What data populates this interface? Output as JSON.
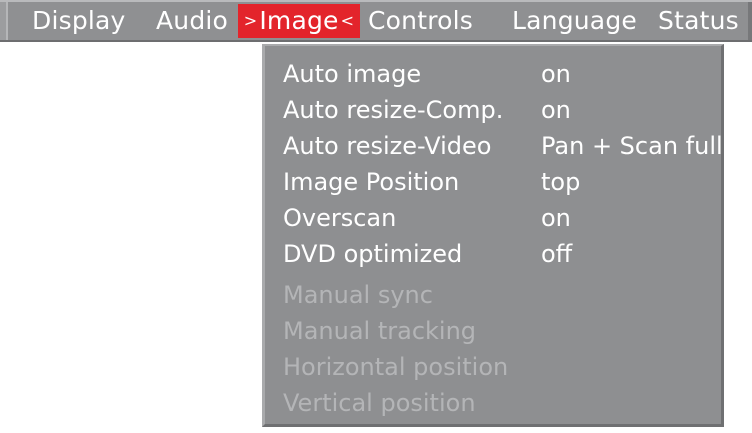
{
  "menubar": {
    "tabs": [
      {
        "label": "Display"
      },
      {
        "label": "Audio"
      },
      {
        "label": "Image",
        "selected": true,
        "left_marker": ">",
        "right_marker": "<"
      },
      {
        "label": "Controls"
      },
      {
        "label": "Language"
      },
      {
        "label": "Status"
      }
    ],
    "colors": {
      "bar": "#8f9092",
      "selected_tab": "#e3242b",
      "text": "#ffffff"
    }
  },
  "dropdown": {
    "items": [
      {
        "label": "Auto image",
        "value": "on",
        "enabled": true
      },
      {
        "label": "Auto resize-Comp.",
        "value": "on",
        "enabled": true
      },
      {
        "label": "Auto resize-Video",
        "value": "Pan + Scan full",
        "enabled": true
      },
      {
        "label": "Image Position",
        "value": "top",
        "enabled": true
      },
      {
        "label": "Overscan",
        "value": "on",
        "enabled": true
      },
      {
        "label": "DVD optimized",
        "value": "off",
        "enabled": true
      },
      {
        "label": "Manual sync",
        "value": "",
        "enabled": false
      },
      {
        "label": "Manual tracking",
        "value": "",
        "enabled": false
      },
      {
        "label": "Horizontal position",
        "value": "",
        "enabled": false
      },
      {
        "label": "Vertical position",
        "value": "",
        "enabled": false
      }
    ],
    "colors": {
      "background": "#8e8f91",
      "enabled_text": "#ffffff",
      "disabled_text": "#b4b5b7"
    }
  }
}
